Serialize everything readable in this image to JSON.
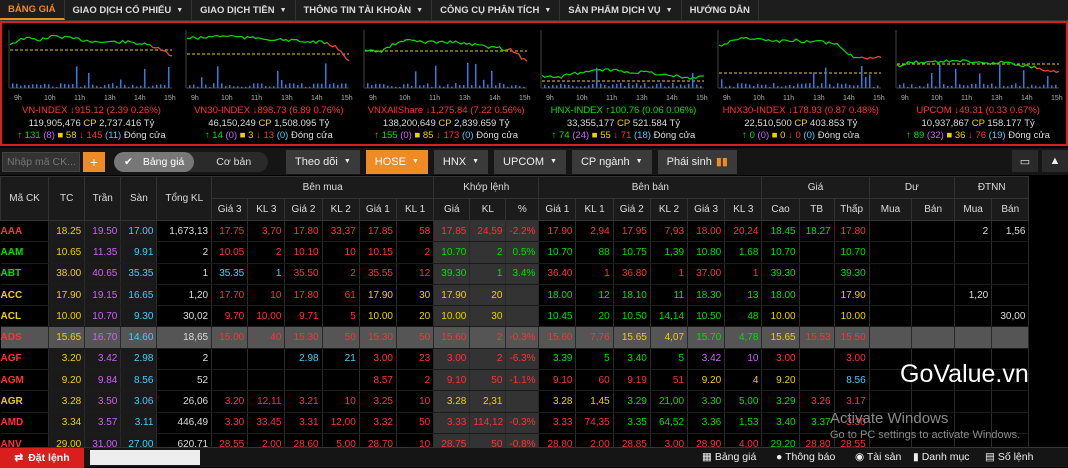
{
  "nav": [
    {
      "label": "BẢNG GIÁ",
      "caret": false,
      "active": true
    },
    {
      "label": "GIAO DỊCH CỔ PHIẾU",
      "caret": true
    },
    {
      "label": "GIAO DỊCH TIỀN",
      "caret": true
    },
    {
      "label": "THÔNG TIN TÀI KHOẢN",
      "caret": true
    },
    {
      "label": "CÔNG CỤ PHÂN TÍCH",
      "caret": true
    },
    {
      "label": "SẢN PHẨM DỊCH VỤ",
      "caret": true
    },
    {
      "label": "HƯỚNG DẪN",
      "caret": false
    }
  ],
  "indices": [
    {
      "name": "VN-INDEX",
      "value": "915.12",
      "change": "(2.39 0.26%)",
      "direction": "down",
      "volume": "119,905,476",
      "cp_value": "2,737.416",
      "cp_unit": "Tỷ",
      "advances": "131",
      "adv_ceil": "(8)",
      "unchanged": "58",
      "declines": "145",
      "dec_floor": "(11)",
      "status": "Đóng cửa",
      "time_labels": [
        "9h",
        "10h",
        "11h",
        "13h",
        "14h",
        "15h"
      ]
    },
    {
      "name": "VN30-INDEX",
      "value": "898.73",
      "change": "(6.89 0.76%)",
      "direction": "down",
      "volume": "46,150,249",
      "cp_value": "1,508.095",
      "cp_unit": "Tỷ",
      "advances": "14",
      "adv_ceil": "(0)",
      "unchanged": "3",
      "declines": "13",
      "dec_floor": "(0)",
      "status": "Đóng cửa",
      "time_labels": [
        "9h",
        "10h",
        "11h",
        "13h",
        "14h",
        "15h"
      ]
    },
    {
      "name": "VNXAllShare",
      "value": "1,275.84",
      "change": "(7.22 0.56%)",
      "direction": "down",
      "volume": "138,200,649",
      "cp_value": "2,839.659",
      "cp_unit": "Tỷ",
      "advances": "155",
      "adv_ceil": "(0)",
      "unchanged": "85",
      "declines": "173",
      "dec_floor": "(0)",
      "status": "Đóng cửa",
      "time_labels": [
        "9h",
        "10h",
        "11h",
        "13h",
        "14h",
        "15h"
      ]
    },
    {
      "name": "HNX-INDEX",
      "value": "100.76",
      "change": "(0.06 0.06%)",
      "direction": "up",
      "volume": "33,355,177",
      "cp_value": "521.584",
      "cp_unit": "Tỷ",
      "advances": "74",
      "adv_ceil": "(24)",
      "unchanged": "55",
      "declines": "71",
      "dec_floor": "(18)",
      "status": "Đóng cửa",
      "time_labels": [
        "9h",
        "10h",
        "11h",
        "13h",
        "14h",
        "15h"
      ]
    },
    {
      "name": "HNX30-INDEX",
      "value": "178.93",
      "change": "(0.87 0.48%)",
      "direction": "down",
      "volume": "22,510,500",
      "cp_value": "403.853",
      "cp_unit": "Tỷ",
      "advances": "0",
      "adv_ceil": "(0)",
      "unchanged": "0",
      "declines": "0",
      "dec_floor": "(0)",
      "status": "Đóng cửa",
      "time_labels": [
        "9h",
        "10h",
        "11h",
        "13h",
        "14h",
        "15h"
      ]
    },
    {
      "name": "UPCOM",
      "value": "49.31",
      "change": "(0.33 0.67%)",
      "direction": "down",
      "volume": "10,937,867",
      "cp_value": "158.177",
      "cp_unit": "Tỷ",
      "advances": "89",
      "adv_ceil": "(32)",
      "unchanged": "36",
      "declines": "76",
      "dec_floor": "(19)",
      "status": "Đóng cửa",
      "time_labels": [
        "9h",
        "10h",
        "11h",
        "13h",
        "14h",
        "15h"
      ]
    }
  ],
  "cp_label": "CP",
  "toolbar": {
    "search_placeholder": "Nhập mã CK...",
    "add_label": "+",
    "price_board_label": "Bảng giá",
    "basic_label": "Cơ bản",
    "theo_doi": "Theo dõi",
    "hose": "HOSE",
    "hnx": "HNX",
    "upcom": "UPCOM",
    "cp_nganh": "CP ngành",
    "phai_sinh": "Phái sinh"
  },
  "table_headers": {
    "top": [
      "Mã CK",
      "TC",
      "Trần",
      "Sàn",
      "Tổng KL",
      "Bên mua",
      "Khớp lệnh",
      "Bên bán",
      "Giá",
      "Dư",
      "ĐTNN"
    ],
    "sub": [
      "Giá 3",
      "KL 3",
      "Giá 2",
      "KL 2",
      "Giá 1",
      "KL 1",
      "Giá",
      "KL",
      "%",
      "Giá 1",
      "KL 1",
      "Giá 2",
      "KL 2",
      "Giá 3",
      "KL 3",
      "Cao",
      "TB",
      "Thấp",
      "Mua",
      "Bán",
      "Mua",
      "Bán"
    ]
  },
  "rows": [
    {
      "sym": "AAA",
      "c": "down",
      "tc": "18.25",
      "tr": "19.50",
      "sn": "17.00",
      "tkl": "1,673,13",
      "b": [
        "17.75",
        "3,70",
        "17.80",
        "33,37",
        "17.85",
        "58"
      ],
      "m": [
        "17.85",
        "24,59",
        "-2.2%"
      ],
      "s": [
        "17.90",
        "2,94",
        "17.95",
        "7,93",
        "18.00",
        "20,24"
      ],
      "g": [
        "18.45",
        "18.27",
        "17.80"
      ],
      "du": [
        "",
        ""
      ],
      "nn": [
        "2",
        "1,56"
      ]
    },
    {
      "sym": "AAM",
      "c": "up",
      "tc": "10.65",
      "tr": "11.35",
      "sn": "9.91",
      "tkl": "2",
      "b": [
        "10.05",
        "2",
        "10.10",
        "10",
        "10.15",
        "2"
      ],
      "m": [
        "10.70",
        "2",
        "0.5%"
      ],
      "s": [
        "10.70",
        "88",
        "10.75",
        "1,39",
        "10.80",
        "1,68"
      ],
      "g": [
        "10.70",
        "",
        "10.70"
      ],
      "du": [
        "",
        ""
      ],
      "nn": [
        "",
        ""
      ]
    },
    {
      "sym": "ABT",
      "c": "up",
      "tc": "38.00",
      "tr": "40.65",
      "sn": "35.35",
      "tkl": "1",
      "b": [
        "35.35",
        "1",
        "35.50",
        "2",
        "35.55",
        "12"
      ],
      "m": [
        "39.30",
        "1",
        "3.4%"
      ],
      "s": [
        "36.40",
        "1",
        "36.80",
        "1",
        "37.00",
        "1"
      ],
      "g": [
        "39.30",
        "",
        "39.30"
      ],
      "du": [
        "",
        ""
      ],
      "nn": [
        "",
        ""
      ]
    },
    {
      "sym": "ACC",
      "c": "ref",
      "tc": "17.90",
      "tr": "19.15",
      "sn": "16.65",
      "tkl": "1,20",
      "b": [
        "17.70",
        "10",
        "17.80",
        "61",
        "17.90",
        "30"
      ],
      "m": [
        "17.90",
        "20",
        ""
      ],
      "s": [
        "18.00",
        "12",
        "18.10",
        "11",
        "18.30",
        "13"
      ],
      "g": [
        "18.00",
        "",
        "17.90"
      ],
      "du": [
        "",
        ""
      ],
      "nn": [
        "1,20",
        ""
      ]
    },
    {
      "sym": "ACL",
      "c": "ref",
      "tc": "10.00",
      "tr": "10.70",
      "sn": "9.30",
      "tkl": "30,02",
      "b": [
        "9.70",
        "10,00",
        "9.71",
        "5",
        "10.00",
        "20"
      ],
      "m": [
        "10.00",
        "30",
        ""
      ],
      "s": [
        "10.45",
        "20",
        "10.50",
        "14,14",
        "10.50",
        "48"
      ],
      "g": [
        "10.00",
        "",
        "10.00"
      ],
      "du": [
        "",
        ""
      ],
      "nn": [
        "",
        "30,00"
      ]
    },
    {
      "sym": "ADS",
      "c": "down",
      "alt": true,
      "tc": "15.65",
      "tr": "16.70",
      "sn": "14.60",
      "tkl": "18,65",
      "b": [
        "15.00",
        "40",
        "15.30",
        "50",
        "15.30",
        "50"
      ],
      "m": [
        "15.60",
        "2",
        "-0.3%"
      ],
      "s": [
        "15.60",
        "7,76",
        "15.65",
        "4,07",
        "15.70",
        "4,78"
      ],
      "g": [
        "15.65",
        "15.53",
        "15.50"
      ],
      "du": [
        "",
        ""
      ],
      "nn": [
        "",
        ""
      ]
    },
    {
      "sym": "AGF",
      "c": "down",
      "tc": "3.20",
      "tr": "3.42",
      "sn": "2.98",
      "tkl": "2",
      "b": [
        "",
        "",
        "2.98",
        "21",
        "3.00",
        "23"
      ],
      "m": [
        "3.00",
        "2",
        "-6.3%"
      ],
      "s": [
        "3.39",
        "5",
        "3.40",
        "5",
        "3.42",
        "10"
      ],
      "g": [
        "3.00",
        "",
        "3.00"
      ],
      "du": [
        "",
        ""
      ],
      "nn": [
        "",
        ""
      ]
    },
    {
      "sym": "AGM",
      "c": "down",
      "tc": "9.20",
      "tr": "9.84",
      "sn": "8.56",
      "tkl": "52",
      "b": [
        "",
        "",
        "",
        "",
        "8.57",
        "2"
      ],
      "m": [
        "9.10",
        "50",
        "-1.1%"
      ],
      "s": [
        "9.10",
        "60",
        "9.19",
        "51",
        "9.20",
        "4"
      ],
      "g": [
        "9.20",
        "",
        "8.56"
      ],
      "du": [
        "",
        ""
      ],
      "nn": [
        "",
        ""
      ]
    },
    {
      "sym": "AGR",
      "c": "ref",
      "tc": "3.28",
      "tr": "3.50",
      "sn": "3.06",
      "tkl": "26,06",
      "b": [
        "3.20",
        "12,11",
        "3.21",
        "10",
        "3.25",
        "10"
      ],
      "m": [
        "3.28",
        "2,31",
        ""
      ],
      "s": [
        "3.28",
        "1,45",
        "3.29",
        "21,00",
        "3.30",
        "5,00"
      ],
      "g": [
        "3.29",
        "3.26",
        "3.17"
      ],
      "du": [
        "",
        ""
      ],
      "nn": [
        "",
        ""
      ]
    },
    {
      "sym": "AMD",
      "c": "down",
      "tc": "3.34",
      "tr": "3.57",
      "sn": "3.11",
      "tkl": "446,49",
      "b": [
        "3.30",
        "33,45",
        "3.31",
        "12,00",
        "3.32",
        "50"
      ],
      "m": [
        "3.33",
        "114,12",
        "-0.3%"
      ],
      "s": [
        "3.33",
        "74,35",
        "3.35",
        "64,52",
        "3.36",
        "1,53"
      ],
      "g": [
        "3.40",
        "3.37",
        "3.30"
      ],
      "du": [
        "",
        ""
      ],
      "nn": [
        "",
        ""
      ]
    },
    {
      "sym": "ANV",
      "c": "down",
      "tc": "29.00",
      "tr": "31.00",
      "sn": "27.00",
      "tkl": "620,71",
      "b": [
        "28.55",
        "2,00",
        "28.60",
        "5,00",
        "28.70",
        "10"
      ],
      "m": [
        "28.75",
        "50",
        "-0.8%"
      ],
      "s": [
        "28.80",
        "2,00",
        "28.85",
        "3,00",
        "28.90",
        "4,00"
      ],
      "g": [
        "29.20",
        "28.80",
        "28.55"
      ],
      "du": [
        "",
        ""
      ],
      "nn": [
        "",
        ""
      ]
    }
  ],
  "footer": {
    "order_label": "Đặt lệnh",
    "items": [
      "Bảng giá",
      "Thông báo",
      "Tài sản",
      "Danh mục",
      "Số lệnh"
    ]
  },
  "watermark": "GoValue.vn",
  "activate": {
    "title": "Activate Windows",
    "subtitle": "Go to PC settings to activate Windows."
  },
  "colors": {
    "accent": "#f08a24",
    "up": "#00e000",
    "down": "#ff3333",
    "ref": "#f0d000",
    "ceiling": "#d060ff",
    "floor": "#40d0ff",
    "panel_border": "#d91e1e"
  }
}
